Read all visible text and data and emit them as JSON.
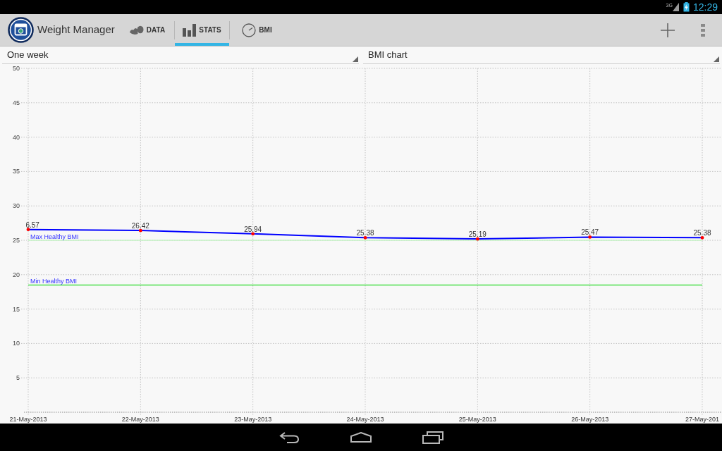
{
  "status_bar": {
    "network": "3G",
    "time": "12:29"
  },
  "action_bar": {
    "title": "Weight Manager",
    "tabs": [
      {
        "label": "DATA",
        "selected": false
      },
      {
        "label": "STATS",
        "selected": true
      },
      {
        "label": "BMI",
        "selected": false
      }
    ]
  },
  "spinners": [
    {
      "value": "One week"
    },
    {
      "value": "BMI chart"
    }
  ],
  "chart": {
    "chart_data": {
      "type": "line",
      "categories": [
        "21-May-2013",
        "22-May-2013",
        "23-May-2013",
        "24-May-2013",
        "25-May-2013",
        "26-May-2013",
        "27-May-201"
      ],
      "series": [
        {
          "color": "#0000ff",
          "values": [
            26.57,
            26.42,
            25.94,
            25.38,
            25.19,
            25.47,
            25.38
          ]
        }
      ],
      "ylim": [
        0,
        50
      ],
      "yticks": [
        5,
        10,
        15,
        20,
        25,
        30,
        35,
        40,
        45,
        50
      ],
      "grid": true,
      "value_labels": [
        "6.57",
        "26.42",
        "25.94",
        "25.38",
        "25.19",
        "25.47",
        "25.38"
      ],
      "ref_lines": [
        {
          "axis": "y",
          "value": 25,
          "label": "Max Healthy BMI",
          "color": "#c4f2c4"
        },
        {
          "axis": "y",
          "value": 18.5,
          "label": "Min Healthy BMI",
          "color": "#4ddf4d"
        }
      ]
    }
  }
}
